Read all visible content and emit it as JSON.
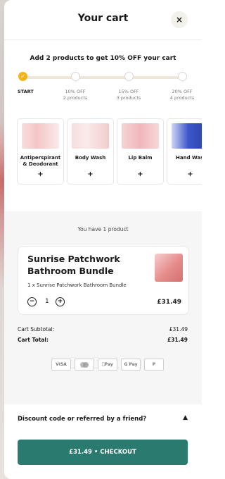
{
  "header": {
    "title": "Your cart",
    "close_label": "×"
  },
  "promo": {
    "text": "Add 2 products to get 10% OFF your cart"
  },
  "progress": {
    "steps": [
      {
        "line1": "START",
        "line2": ""
      },
      {
        "line1": "10% OFF",
        "line2": "2 products"
      },
      {
        "line1": "15% OFF",
        "line2": "3 products"
      },
      {
        "line1": "20% OFF",
        "line2": "4 products"
      }
    ],
    "completed_icon": "✓"
  },
  "recommended": [
    {
      "name_line1": "Antiperspirant",
      "name_line2": "& Deodorant",
      "add": "+"
    },
    {
      "name_line1": "Body Wash",
      "name_line2": "",
      "add": "+"
    },
    {
      "name_line1": "Lip Balm",
      "name_line2": "",
      "add": "+"
    },
    {
      "name_line1": "Hand Was",
      "name_line2": "",
      "add": "+"
    }
  ],
  "cart": {
    "count_text": "You have 1 product",
    "item": {
      "title": "Sunrise Patchwork Bathroom Bundle",
      "subtitle": "1 x Sunrise Patchwork Bathroom Bundle",
      "qty": "1",
      "minus": "−",
      "plus": "+",
      "price": "£31.49"
    },
    "subtotal_label": "Cart Subtotal:",
    "subtotal_value": "£31.49",
    "total_label": "Cart Total:",
    "total_value": "£31.49"
  },
  "payments": [
    "VISA",
    "MC",
    "Pay",
    "G Pay",
    "P"
  ],
  "discount": {
    "label": "Discount code or referred by a friend?",
    "chevron": "▲"
  },
  "checkout": {
    "label": "£31.49  •  CHECKOUT"
  }
}
